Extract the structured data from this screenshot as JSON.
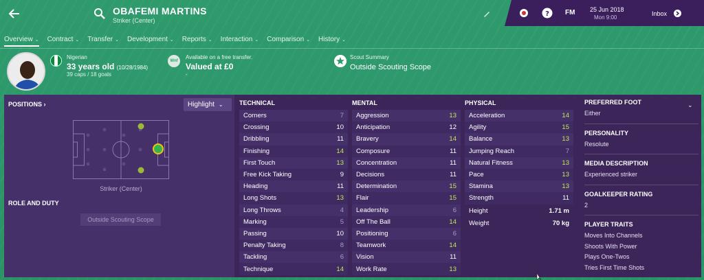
{
  "header": {
    "player_name": "OBAFEMI MARTINS",
    "player_position": "Striker (Center)",
    "fm_label": "FM",
    "date": "25 Jun 2018",
    "time": "Mon 9:00",
    "inbox": "Inbox"
  },
  "tabs": [
    {
      "label": "Overview"
    },
    {
      "label": "Contract"
    },
    {
      "label": "Transfer"
    },
    {
      "label": "Development"
    },
    {
      "label": "Reports"
    },
    {
      "label": "Interaction"
    },
    {
      "label": "Comparison"
    },
    {
      "label": "History"
    }
  ],
  "info": {
    "nationality": "Nigerian",
    "age": "33 years old",
    "dob": "(10/28/1984)",
    "caps": "39 caps / 18 goals",
    "wage_icon_text": "Wnf",
    "transfer_status": "Available on a free transfer.",
    "value": "Valued at £0",
    "value_sub": "-",
    "scout_title": "Scout Summary",
    "scout_value": "Outside Scouting Scope"
  },
  "positions": {
    "title": "POSITIONS ›",
    "highlight": "Highlight",
    "position_label": "Striker (Center)",
    "role_title": "ROLE AND DUTY",
    "role_button": "Outside Scouting Scope"
  },
  "technical": {
    "title": "TECHNICAL",
    "attrs": [
      {
        "name": "Corners",
        "value": "7"
      },
      {
        "name": "Crossing",
        "value": "10"
      },
      {
        "name": "Dribbling",
        "value": "11"
      },
      {
        "name": "Finishing",
        "value": "14"
      },
      {
        "name": "First Touch",
        "value": "13"
      },
      {
        "name": "Free Kick Taking",
        "value": "9"
      },
      {
        "name": "Heading",
        "value": "11"
      },
      {
        "name": "Long Shots",
        "value": "13"
      },
      {
        "name": "Long Throws",
        "value": "4"
      },
      {
        "name": "Marking",
        "value": "5"
      },
      {
        "name": "Passing",
        "value": "10"
      },
      {
        "name": "Penalty Taking",
        "value": "8"
      },
      {
        "name": "Tackling",
        "value": "6"
      },
      {
        "name": "Technique",
        "value": "14"
      }
    ]
  },
  "mental": {
    "title": "MENTAL",
    "attrs": [
      {
        "name": "Aggression",
        "value": "13"
      },
      {
        "name": "Anticipation",
        "value": "12"
      },
      {
        "name": "Bravery",
        "value": "14"
      },
      {
        "name": "Composure",
        "value": "11"
      },
      {
        "name": "Concentration",
        "value": "11"
      },
      {
        "name": "Decisions",
        "value": "11"
      },
      {
        "name": "Determination",
        "value": "15"
      },
      {
        "name": "Flair",
        "value": "15"
      },
      {
        "name": "Leadership",
        "value": "6"
      },
      {
        "name": "Off The Ball",
        "value": "14"
      },
      {
        "name": "Positioning",
        "value": "6"
      },
      {
        "name": "Teamwork",
        "value": "14"
      },
      {
        "name": "Vision",
        "value": "11"
      },
      {
        "name": "Work Rate",
        "value": "13"
      }
    ]
  },
  "physical": {
    "title": "PHYSICAL",
    "attrs": [
      {
        "name": "Acceleration",
        "value": "14"
      },
      {
        "name": "Agility",
        "value": "15"
      },
      {
        "name": "Balance",
        "value": "13"
      },
      {
        "name": "Jumping Reach",
        "value": "7"
      },
      {
        "name": "Natural Fitness",
        "value": "13"
      },
      {
        "name": "Pace",
        "value": "13"
      },
      {
        "name": "Stamina",
        "value": "13"
      },
      {
        "name": "Strength",
        "value": "11"
      }
    ],
    "height_label": "Height",
    "height": "1.71 m",
    "weight_label": "Weight",
    "weight": "70 kg"
  },
  "side": {
    "preferred_foot_title": "PREFERRED FOOT",
    "preferred_foot": "Either",
    "personality_title": "PERSONALITY",
    "personality": "Resolute",
    "media_title": "MEDIA DESCRIPTION",
    "media": "Experienced striker",
    "gk_title": "GOALKEEPER RATING",
    "gk": "2",
    "traits_title": "PLAYER TRAITS",
    "traits": [
      "Moves Into Channels",
      "Shoots With Power",
      "Plays One-Twos",
      "Tries First Time Shots"
    ]
  },
  "colors": {
    "background": "#2e9a6c",
    "panel": "#3b2559",
    "accent_green": "#c4e85a",
    "grey_value": "#a99fc0"
  }
}
